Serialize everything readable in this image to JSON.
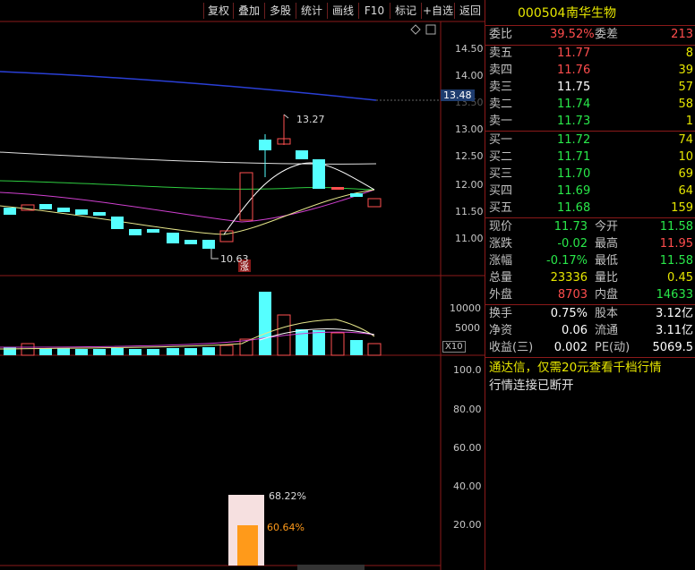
{
  "toolbar": {
    "buttons": [
      "复权",
      "叠加",
      "多股",
      "统计",
      "画线",
      "F10",
      "标记",
      "+自选",
      "返回"
    ]
  },
  "stock": {
    "code": "000504",
    "name": "南华生物"
  },
  "price_axis": {
    "ticks": [
      "14.50",
      "14.00",
      "13.50",
      "13.00",
      "12.50",
      "12.00",
      "11.50",
      "11.00"
    ],
    "current": "13.48"
  },
  "annotations": {
    "high": "13.27",
    "low": "10.63",
    "limit_up_badge": "涨"
  },
  "volume_axis": {
    "ticks": [
      "10000",
      "5000"
    ],
    "unit": "X10"
  },
  "lower_axis": {
    "ticks": [
      "100.0",
      "80.00",
      "60.00",
      "40.00",
      "20.00"
    ]
  },
  "lower_labels": {
    "a": "68.22%",
    "b": "60.64%"
  },
  "quote": {
    "wei": {
      "label1": "委比",
      "v1": "39.52%",
      "label2": "委差",
      "v2": "213"
    },
    "sell": [
      {
        "label": "卖五",
        "price": "11.77",
        "vol": "8"
      },
      {
        "label": "卖四",
        "price": "11.76",
        "vol": "39"
      },
      {
        "label": "卖三",
        "price": "11.75",
        "vol": "57"
      },
      {
        "label": "卖二",
        "price": "11.74",
        "vol": "58"
      },
      {
        "label": "卖一",
        "price": "11.73",
        "vol": "1"
      }
    ],
    "buy": [
      {
        "label": "买一",
        "price": "11.72",
        "vol": "74"
      },
      {
        "label": "买二",
        "price": "11.71",
        "vol": "10"
      },
      {
        "label": "买三",
        "price": "11.70",
        "vol": "69"
      },
      {
        "label": "买四",
        "price": "11.69",
        "vol": "64"
      },
      {
        "label": "买五",
        "price": "11.68",
        "vol": "159"
      }
    ],
    "stats": [
      {
        "l1": "现价",
        "v1": "11.73",
        "l2": "今开",
        "v2": "11.58"
      },
      {
        "l1": "涨跌",
        "v1": "-0.02",
        "l2": "最高",
        "v2": "11.95"
      },
      {
        "l1": "涨幅",
        "v1": "-0.17%",
        "l2": "最低",
        "v2": "11.58"
      },
      {
        "l1": "总量",
        "v1": "23336",
        "l2": "量比",
        "v2": "0.45"
      },
      {
        "l1": "外盘",
        "v1": "8703",
        "l2": "内盘",
        "v2": "14633"
      }
    ],
    "fund": [
      {
        "l1": "换手",
        "v1": "0.75%",
        "l2": "股本",
        "v2": "3.12亿"
      },
      {
        "l1": "净资",
        "v1": "0.06",
        "l2": "流通",
        "v2": "3.11亿"
      },
      {
        "l1": "收益(三)",
        "v1": "0.002",
        "l2": "PE(动)",
        "v2": "5069.5"
      }
    ],
    "notice1": "通达信，仅需20元查看千档行情",
    "notice2": "行情连接已断开"
  }
}
